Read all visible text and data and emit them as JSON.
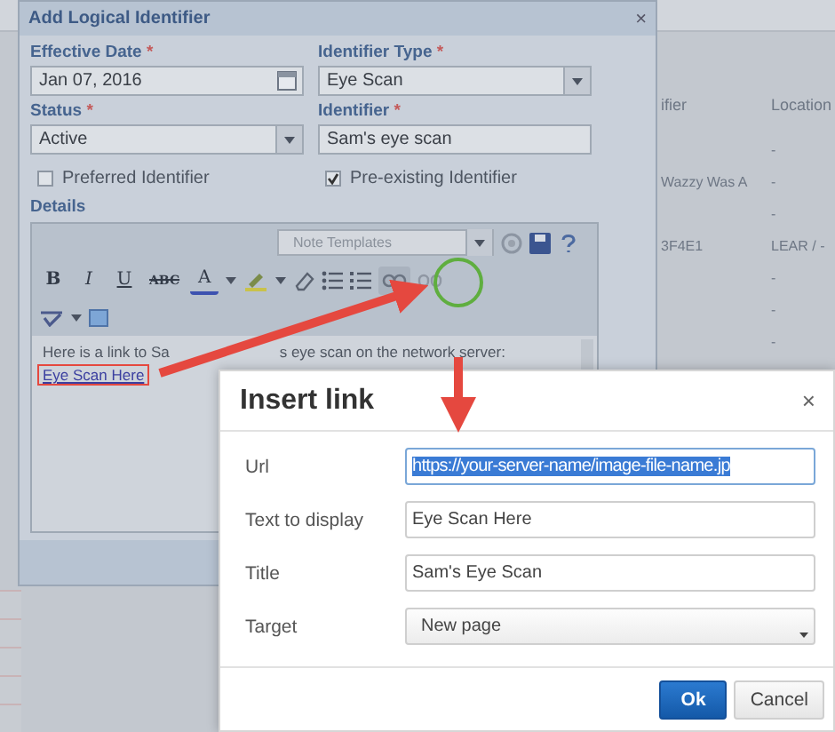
{
  "background_table": {
    "columns": [
      "ifier",
      "Location"
    ],
    "rows": [
      {
        "column_2": "-"
      },
      {
        "column_1": "Wazzy Was A",
        "column_2": "-"
      },
      {
        "column_2": "-"
      },
      {
        "column_1": "3F4E1",
        "column_2": "LEAR / -"
      },
      {
        "column_2": "-"
      },
      {
        "column_2": "-"
      },
      {
        "column_2": "-"
      }
    ]
  },
  "dialog": {
    "title": "Add Logical Identifier",
    "close": "×",
    "fields": [
      {
        "label": "Effective Date",
        "required_mark": "*",
        "kind": "date",
        "value": "Jan 07, 2016"
      },
      {
        "label": "Identifier Type",
        "required_mark": "*",
        "kind": "select",
        "value": "Eye Scan"
      },
      {
        "label": "Status",
        "required_mark": "*",
        "kind": "select",
        "value": "Active"
      },
      {
        "label": "Identifier",
        "required_mark": "*",
        "kind": "text",
        "value": "Sam's eye scan"
      }
    ],
    "checkboxes": [
      {
        "label": "Preferred Identifier",
        "checked": false
      },
      {
        "label": "Pre-existing Identifier",
        "checked": true
      }
    ],
    "details": {
      "label": "Details",
      "template_placeholder": "Note Templates",
      "format_buttons": [
        {
          "label": "B",
          "kind": "bold"
        },
        {
          "label": "I",
          "kind": "italic"
        },
        {
          "label": "U",
          "kind": "underline"
        },
        {
          "label": "ABC",
          "kind": "strike"
        }
      ],
      "font_color_label": "A",
      "text_before_arrow": "Here is a link to Sa",
      "text_after_arrow": "s eye scan on the network server:",
      "link": "Eye Scan Here"
    }
  },
  "insert_link": {
    "title": "Insert link",
    "close": "×",
    "fields": [
      {
        "label": "Url",
        "kind": "text",
        "value": "https://your-server-name/image-file-name.jp",
        "text_selected": true
      },
      {
        "label": "Text to display",
        "kind": "text",
        "value": "Eye Scan Here",
        "text_selected": false
      },
      {
        "label": "Title",
        "kind": "text",
        "value": "Sam's Eye Scan",
        "text_selected": false
      },
      {
        "label": "Target",
        "kind": "select",
        "value": "New page",
        "text_selected": false
      }
    ],
    "buttons": [
      {
        "label": "Ok",
        "primary": true
      },
      {
        "label": "Cancel",
        "primary": false
      }
    ]
  }
}
